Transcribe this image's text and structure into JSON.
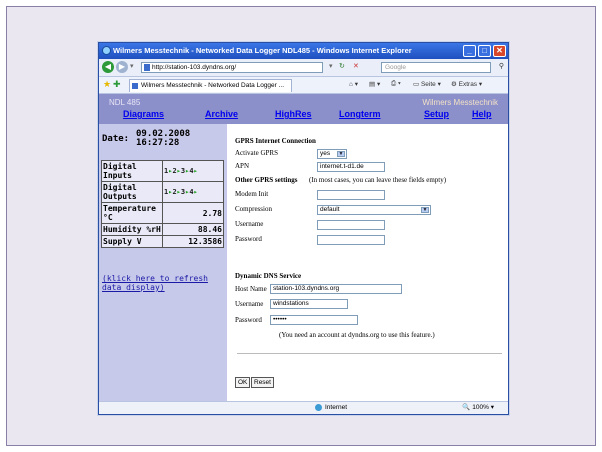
{
  "window": {
    "title": "Wilmers Messtechnik - Networked Data Logger NDL485 - Windows Internet Explorer",
    "buttons": {
      "minimize": "_",
      "maximize": "□",
      "close": "✕"
    }
  },
  "navbar": {
    "back_icon": "back-arrow-icon",
    "forward_icon": "forward-arrow-icon",
    "address": "http://station-103.dyndns.org/",
    "search_placeholder": "Google"
  },
  "tabbar": {
    "tab_title": "Wilmers Messtechnik - Networked Data Logger ...",
    "page_menu": "Seite",
    "tools_menu": "Extras"
  },
  "banner": {
    "left_title": "NDL 485",
    "right_title": "Wilmers Messtechnik",
    "links": [
      "Diagrams",
      "Archive",
      "HighRes",
      "Longterm",
      "Setup",
      "Help"
    ]
  },
  "sidebar": {
    "date_label": "Date:",
    "date": "09.02.2008",
    "time": "16:27:28",
    "digital_inputs_label": "Digital Inputs",
    "digital_outputs_label": "Digital Outputs",
    "channels": [
      "1",
      "2",
      "3",
      "4"
    ],
    "temperature_label": "Temperature °C",
    "temperature_value": "2.78",
    "humidity_label": "Humidity %rH",
    "humidity_value": "88.46",
    "supply_label": "Supply V",
    "supply_value": "12.3586",
    "refresh_link": "(klick here to refresh data display)"
  },
  "gprs": {
    "heading": "GPRS Internet Connection",
    "activate_label": "Activate GPRS",
    "activate_value": "yes",
    "apn_label": "APN",
    "apn_value": "internet.t-d1.de",
    "other_heading": "Other GPRS settings",
    "other_note": "(In most cases, you can leave these fields empty)",
    "modem_init_label": "Modem Init",
    "compression_label": "Compression",
    "compression_value": "default",
    "username_label": "Username",
    "password_label": "Password"
  },
  "dns": {
    "heading": "Dynamic DNS Service",
    "host_label": "Host Name",
    "host_value": "station-103.dyndns.org",
    "username_label": "Username",
    "username_value": "windstations",
    "password_label": "Password",
    "password_value": "••••••",
    "note": "(You need an account at dyndns.org to use this feature.)"
  },
  "buttons": {
    "ok": "OK",
    "reset": "Reset"
  },
  "statusbar": {
    "zone": "Internet",
    "zoom": "100%"
  }
}
